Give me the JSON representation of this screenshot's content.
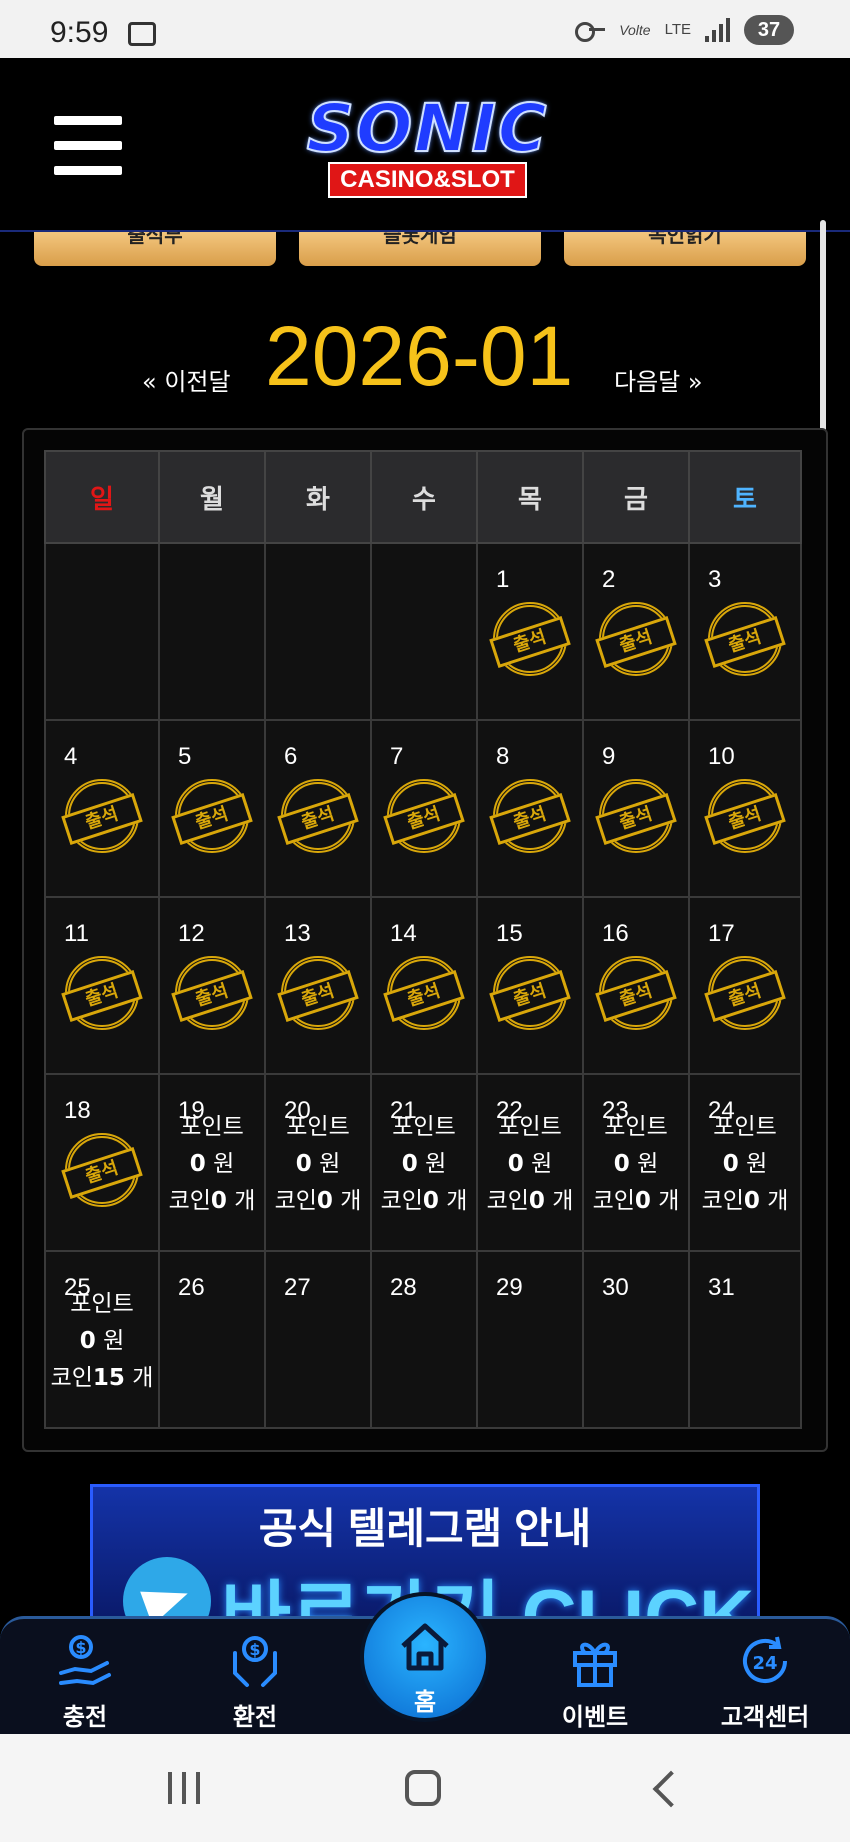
{
  "status": {
    "time": "9:59",
    "volte": "Volte",
    "lte": "LTE",
    "battery": "37"
  },
  "header": {
    "logo_main": "SONIC",
    "logo_sub": "CASINO&SLOT"
  },
  "tabs": [
    "출석부",
    "슬롯게임",
    "녹인읽기"
  ],
  "calendar": {
    "month": "2026-01",
    "prev_label": "« 이전달",
    "next_label": "다음달 »",
    "weekdays": [
      "일",
      "월",
      "화",
      "수",
      "목",
      "금",
      "토"
    ],
    "stamp_text": "출석",
    "point_label": "포인트",
    "coin_label": "코인",
    "won_unit": "원",
    "count_unit": "개",
    "day_19": {
      "points": "0",
      "coins": "0"
    },
    "day_20": {
      "points": "0",
      "coins": "0"
    },
    "day_21": {
      "points": "0",
      "coins": "0"
    },
    "day_22": {
      "points": "0",
      "coins": "0"
    },
    "day_23": {
      "points": "0",
      "coins": "0"
    },
    "day_24": {
      "points": "0",
      "coins": "0"
    },
    "day_25": {
      "points": "0",
      "coins": "15"
    }
  },
  "banner": {
    "line1": "공식 텔레그램 안내",
    "line2": "바로가기 CLICK"
  },
  "bottom_nav": {
    "charge": "충전",
    "exchange": "환전",
    "home": "홈",
    "event": "이벤트",
    "support": "고객센터"
  }
}
